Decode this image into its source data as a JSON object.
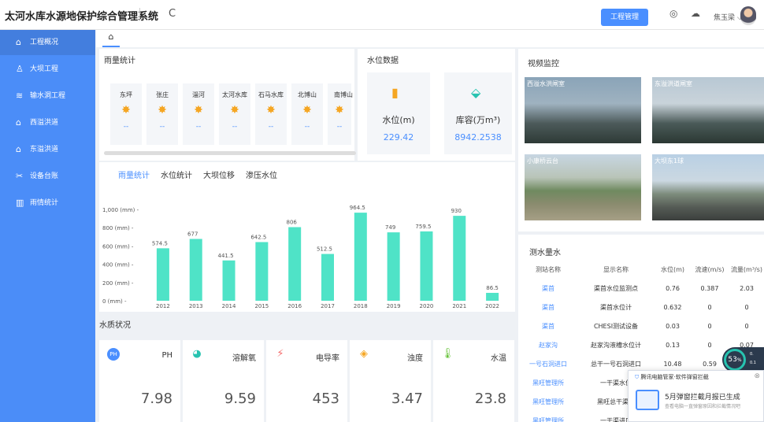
{
  "header": {
    "title": "太河水库水源地保护综合管理系统",
    "collapse_icon": "«",
    "refresh_icon": "C",
    "project_button": "工程管理",
    "user_name": "焦玉梁 ⌵"
  },
  "sidebar": {
    "items": [
      {
        "label": "工程概况",
        "icon": "home-icon"
      },
      {
        "label": "大坝工程",
        "icon": "dam-icon"
      },
      {
        "label": "输水洞工程",
        "icon": "tunnel-icon"
      },
      {
        "label": "西溢洪道",
        "icon": "house-icon"
      },
      {
        "label": "东溢洪道",
        "icon": "house-icon"
      },
      {
        "label": "设备台账",
        "icon": "tools-icon"
      },
      {
        "label": "雨情统计",
        "icon": "bar-chart-icon"
      }
    ]
  },
  "tabs": {
    "home": "⌂"
  },
  "rain": {
    "title": "雨量统计",
    "stations": [
      {
        "name": "东坪",
        "value": "--"
      },
      {
        "name": "张庄",
        "value": "--"
      },
      {
        "name": "淄河",
        "value": "--"
      },
      {
        "name": "太河水库",
        "value": "--"
      },
      {
        "name": "石马水库",
        "value": "--"
      },
      {
        "name": "北博山",
        "value": "--"
      },
      {
        "name": "南博山",
        "value": "--"
      }
    ]
  },
  "water": {
    "title": "水位数据",
    "level_label": "水位(m)",
    "level_value": "229.42",
    "capacity_label": "库容(万m³)",
    "capacity_value": "8942.2538"
  },
  "chart_tabs": [
    "雨量统计",
    "水位统计",
    "大坝位移",
    "渗压水位"
  ],
  "chart_data": {
    "type": "bar",
    "categories": [
      "2012",
      "2013",
      "2014",
      "2015",
      "2016",
      "2017",
      "2018",
      "2019",
      "2020",
      "2021",
      "2022"
    ],
    "values": [
      574.5,
      677,
      441.5,
      642.5,
      806,
      512.5,
      964.5,
      749,
      759.5,
      930,
      86.5
    ],
    "yticks": [
      "1,000 (mm) -",
      "800 (mm) -",
      "600 (mm) -",
      "400 (mm) -",
      "200 (mm) -",
      "0 (mm) -"
    ],
    "ylim": [
      0,
      1000
    ],
    "color": "#4fe3c7"
  },
  "quality": {
    "title": "水质状况",
    "items": [
      {
        "label": "PH",
        "value": "7.98",
        "icon": "ph-icon",
        "color": "#4a8fff"
      },
      {
        "label": "溶解氧",
        "value": "9.59",
        "icon": "oxygen-icon",
        "color": "#27c3b0"
      },
      {
        "label": "电导率",
        "value": "453",
        "icon": "conductivity-icon",
        "color": "#f56c6c"
      },
      {
        "label": "浊度",
        "value": "3.47",
        "icon": "turbidity-icon",
        "color": "#f5a623"
      },
      {
        "label": "水温",
        "value": "23.8",
        "icon": "thermometer-icon",
        "color": "#67c23a"
      }
    ]
  },
  "video": {
    "title": "视频监控",
    "cams": [
      "西溢水洪闸室",
      "东溢洪道闸室",
      "小康桥云台",
      "大坝东1球"
    ]
  },
  "flow": {
    "title": "测水量水",
    "headers": [
      "测站名称",
      "显示名称",
      "水位(m)",
      "流速(m/s)",
      "流量(m³/s)"
    ],
    "rows": [
      [
        "渠首",
        "渠首水位监测点",
        "0.76",
        "0.387",
        "2.03"
      ],
      [
        "渠首",
        "渠首水位计",
        "0.632",
        "0",
        "0"
      ],
      [
        "渠首",
        "CHESI测试设备",
        "0.03",
        "0",
        "0"
      ],
      [
        "赵家沟",
        "赵家沟液槽水位计",
        "0.13",
        "0",
        "0.07"
      ],
      [
        "一号石洞进口",
        "总干一号石洞进口",
        "10.48",
        "0.59",
        ""
      ],
      [
        "黑旺管理所",
        "一干渠水位",
        "",
        "",
        ""
      ],
      [
        "黑旺管理所",
        "黑旺总干渠水",
        "",
        "",
        ""
      ],
      [
        "黑旺管理所",
        "一干渠进口",
        "",
        "",
        ""
      ]
    ]
  },
  "toast": {
    "header": "腾讯电脑管家·软件弹窗拦截",
    "body": "5月弹窗拦截月报已生成",
    "sub": "查看电脑一直弹窗原因和拦截情况吧",
    "close": "⊗"
  },
  "speed": {
    "value": "53",
    "suffix": "%",
    "up": "0.",
    "down": "0.1"
  }
}
